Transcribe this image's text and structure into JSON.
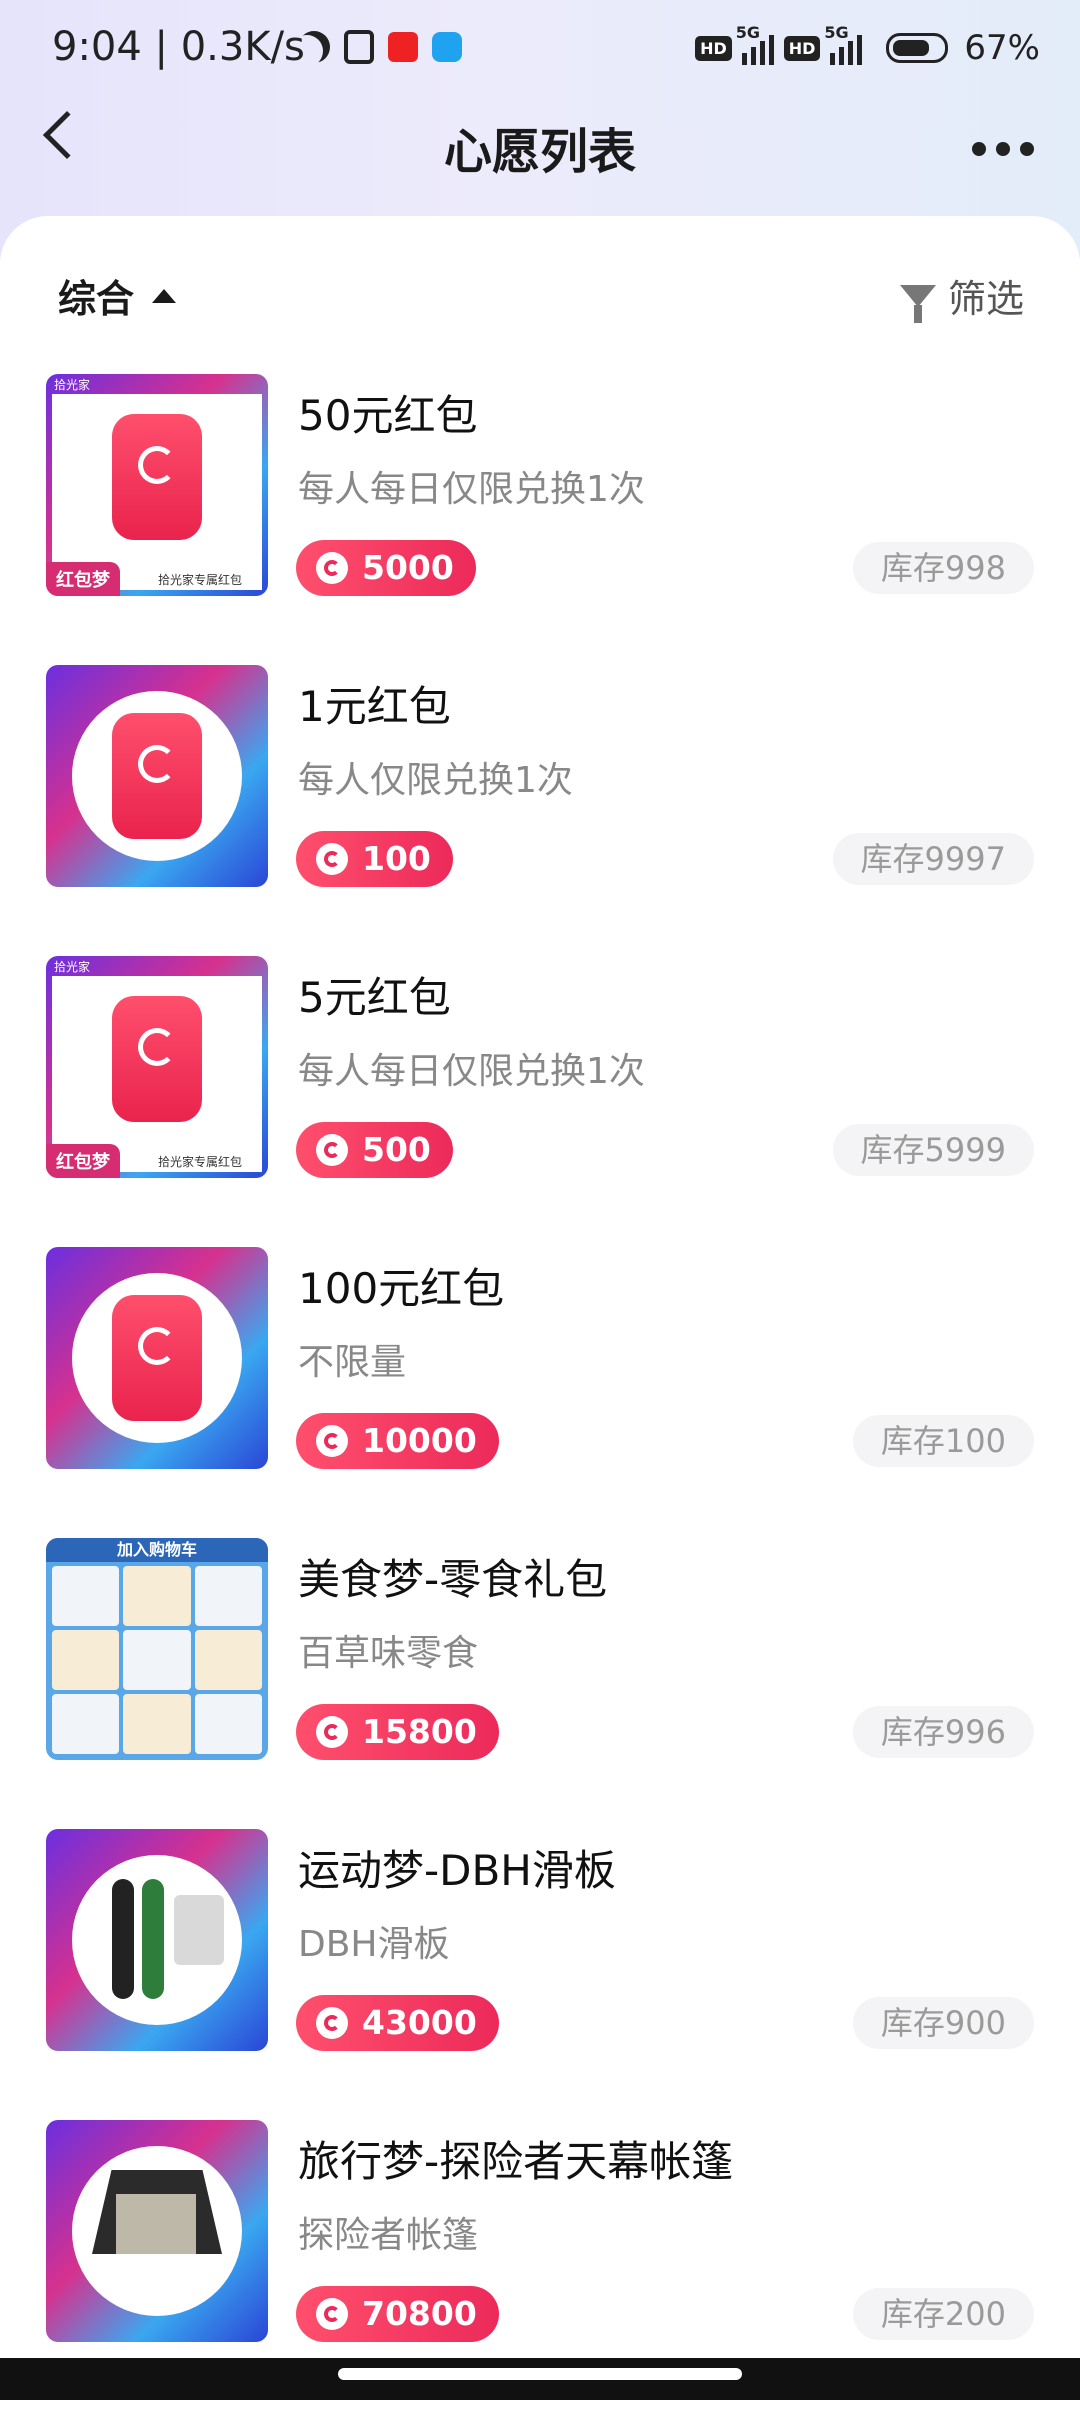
{
  "status_bar": {
    "time": "9:04 | 0.3K/s",
    "hd1": "HD",
    "net1": "5G",
    "hd2": "HD",
    "net2": "5G",
    "battery": "67%"
  },
  "header": {
    "title": "心愿列表"
  },
  "toolbar": {
    "sort_label": "综合",
    "filter_label": "筛选"
  },
  "items": [
    {
      "name": "50元红包",
      "desc": "每人每日仅限兑换1次",
      "price": "5000",
      "stock": "库存998",
      "thumb_tag": "红包梦",
      "thumb_caption": "拾光家专属红包",
      "thumb_top": "拾光家"
    },
    {
      "name": "1元红包",
      "desc": "每人仅限兑换1次",
      "price": "100",
      "stock": "库存9997"
    },
    {
      "name": "5元红包",
      "desc": "每人每日仅限兑换1次",
      "price": "500",
      "stock": "库存5999",
      "thumb_tag": "红包梦",
      "thumb_caption": "拾光家专属红包",
      "thumb_top": "拾光家"
    },
    {
      "name": "100元红包",
      "desc": "不限量",
      "price": "10000",
      "stock": "库存100"
    },
    {
      "name": "美食梦-零食礼包",
      "desc": "百草味零食",
      "price": "15800",
      "stock": "库存996",
      "thumb_band": "加入购物车"
    },
    {
      "name": "运动梦-DBH滑板",
      "desc": "DBH滑板",
      "price": "43000",
      "stock": "库存900"
    },
    {
      "name": "旅行梦-探险者天幕帐篷",
      "desc": "探险者帐篷",
      "price": "70800",
      "stock": "库存200"
    }
  ],
  "colors": {
    "accent": "#ec2a5a",
    "stock_bg": "#f4f4f6"
  }
}
